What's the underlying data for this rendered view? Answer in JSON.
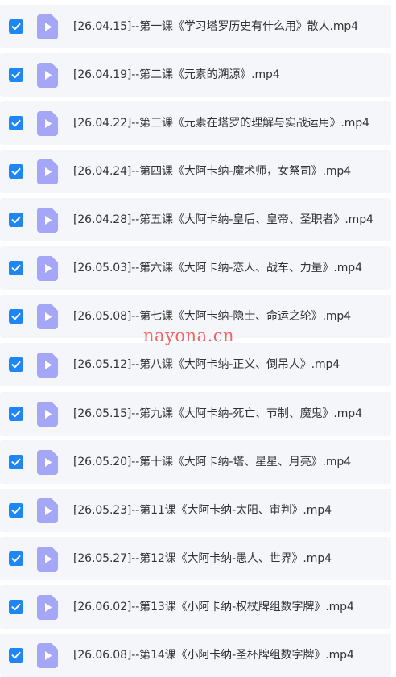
{
  "files": [
    {
      "name": "[26.04.15]--第一课《学习塔罗历史有什么用》散人.mp4",
      "checked": true
    },
    {
      "name": "[26.04.19]--第二课《元素的溯源》.mp4",
      "checked": true
    },
    {
      "name": "[26.04.22]--第三课《元素在塔罗的理解与实战运用》.mp4",
      "checked": true
    },
    {
      "name": "[26.04.24]--第四课《大阿卡纳-魔术师，女祭司》.mp4",
      "checked": true
    },
    {
      "name": "[26.04.28]--第五课《大阿卡纳-皇后、皇帝、圣职者》.mp4",
      "checked": true
    },
    {
      "name": "[26.05.03]--第六课《大阿卡纳-恋人、战车、力量》.mp4",
      "checked": true
    },
    {
      "name": "[26.05.08]--第七课《大阿卡纳-隐士、命运之轮》.mp4",
      "checked": true
    },
    {
      "name": "[26.05.12]--第八课《大阿卡纳-正义、倒吊人》.mp4",
      "checked": true
    },
    {
      "name": "[26.05.15]--第九课《大阿卡纳-死亡、节制、魔鬼》.mp4",
      "checked": true
    },
    {
      "name": "[26.05.20]--第十课《大阿卡纳-塔、星星、月亮》.mp4",
      "checked": true
    },
    {
      "name": "[26.05.23]--第11课《大阿卡纳-太阳、审判》.mp4",
      "checked": true
    },
    {
      "name": "[26.05.27]--第12课《大阿卡纳-愚人、世界》.mp4",
      "checked": true
    },
    {
      "name": "[26.06.02]--第13课《小阿卡纳-权杖牌组数字牌》.mp4",
      "checked": true
    },
    {
      "name": "[26.06.08]--第14课《小阿卡纳-圣杯牌组数字牌》.mp4",
      "checked": true
    }
  ],
  "watermark": "nayona.cn",
  "colors": {
    "checkbox": "#1e86f7",
    "video_icon": "#a5a6f6",
    "row_background": "#f5f6fa"
  },
  "icons": {
    "checkbox": "check-icon",
    "file": "video-file-icon"
  }
}
